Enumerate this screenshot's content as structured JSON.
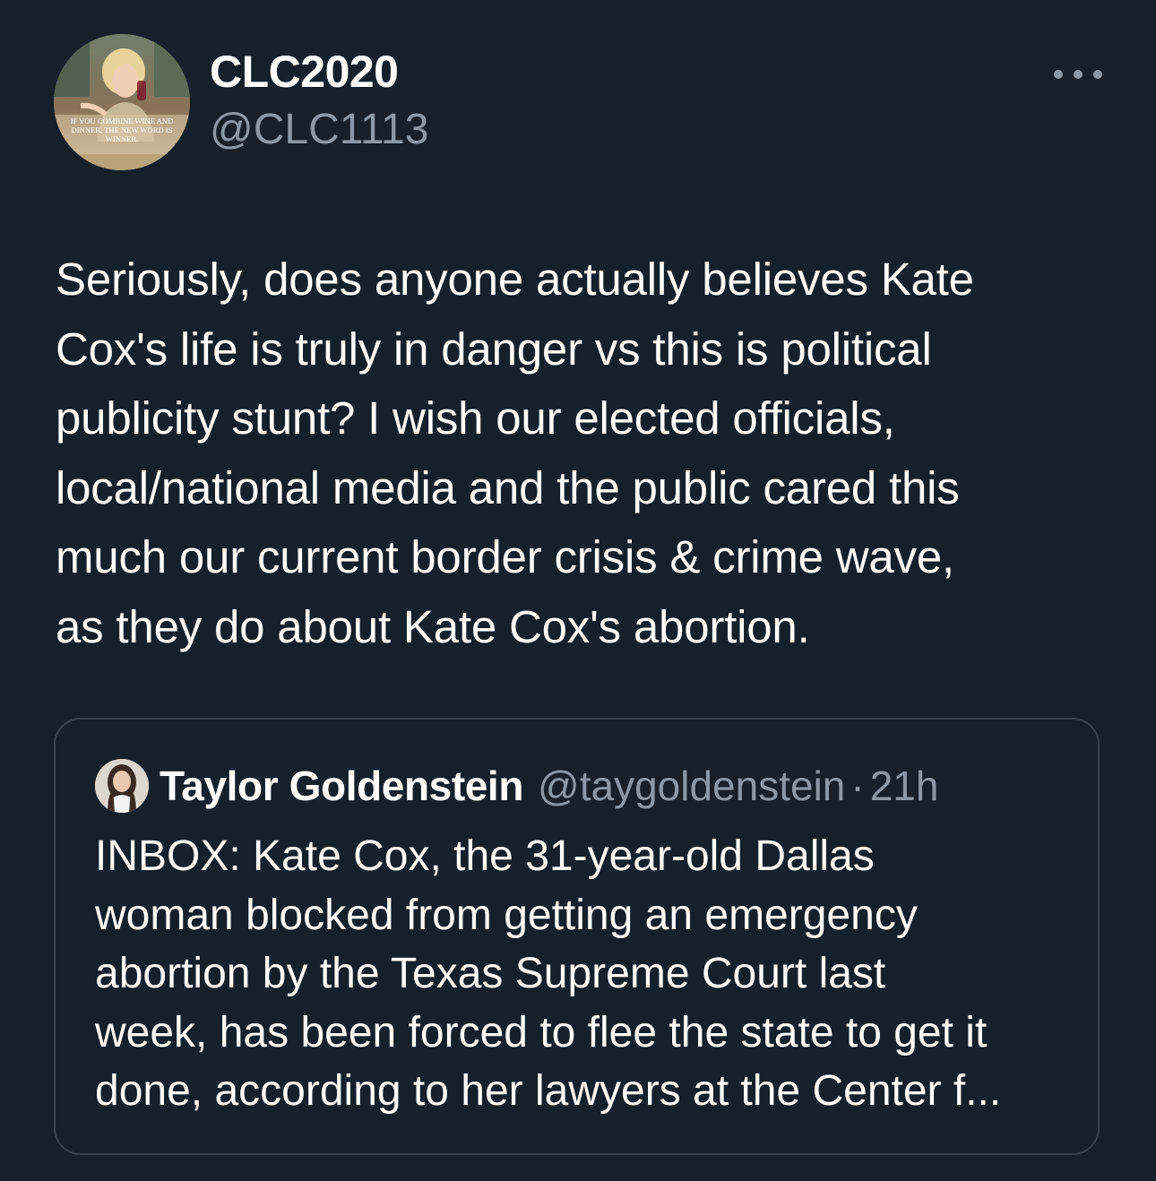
{
  "author": {
    "display_name": "CLC2020",
    "handle": "@CLC1113",
    "avatar_caption": [
      "IF YOU COMBINE WINE AND",
      "DINNER, THE NEW WORD IS",
      "WINNER."
    ]
  },
  "more_icon": "more-horizontal-icon",
  "tweet": {
    "lines": [
      "Seriously, does anyone actually believes Kate",
      "Cox's life is truly in danger vs this is political",
      "publicity stunt? I wish our elected officials,",
      "local/national media and the public cared this",
      "much our current border crisis & crime wave,",
      "as they do about Kate Cox's abortion."
    ]
  },
  "quoted_tweet": {
    "display_name": "Taylor Goldenstein",
    "handle": "@taygoldenstein",
    "separator": "·",
    "time": "21h",
    "lines": [
      "INBOX: Kate Cox, the 31-year-old Dallas",
      "woman blocked from getting an emergency",
      "abortion by the Texas Supreme Court last",
      "week, has been forced to flee the state to get it",
      "done, according to her lawyers at the Center f..."
    ]
  },
  "colors": {
    "background": "#15202b",
    "text_primary": "#ffffff",
    "text_secondary": "#8b98a5",
    "border": "#38444d"
  }
}
